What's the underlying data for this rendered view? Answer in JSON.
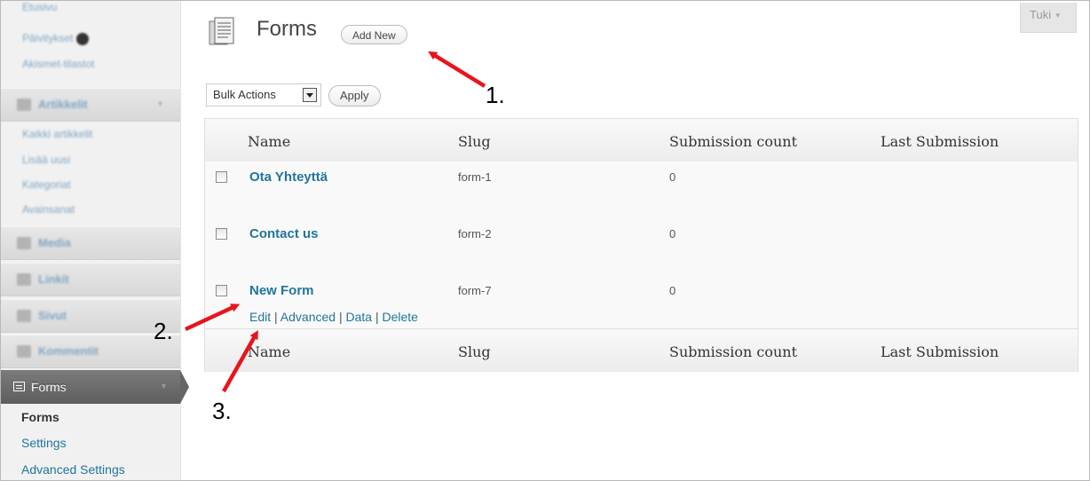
{
  "sidebar": {
    "top_links": [
      "Etusivu",
      "Päivitykset",
      "Akismet-tilastot"
    ],
    "update_badge": "0",
    "posts_header": "Artikkelit",
    "posts_links": [
      "Kaikki artikkelit",
      "Lisää uusi",
      "Kategoriat",
      "Avainsanat"
    ],
    "menu": [
      "Media",
      "Linkit",
      "Sivut",
      "Kommentit"
    ],
    "active_menu": "Forms",
    "submenu": {
      "current": "Forms",
      "items": [
        "Settings",
        "Advanced Settings"
      ]
    }
  },
  "header": {
    "title": "Forms",
    "add_new_label": "Add New",
    "help_tab": "Tuki"
  },
  "toolbar": {
    "bulk_actions_value": "Bulk Actions",
    "apply_label": "Apply"
  },
  "table": {
    "columns": [
      "Name",
      "Slug",
      "Submission count",
      "Last Submission"
    ],
    "rows": [
      {
        "name": "Ota Yhteyttä",
        "slug": "form-1",
        "count": "0",
        "last": ""
      },
      {
        "name": "Contact us",
        "slug": "form-2",
        "count": "0",
        "last": ""
      },
      {
        "name": "New Form",
        "slug": "form-7",
        "count": "0",
        "last": ""
      }
    ],
    "row_actions": [
      "Edit",
      "Advanced",
      "Data",
      "Delete"
    ],
    "action_separator": "|"
  },
  "annotations": {
    "labels": [
      "1.",
      "2.",
      "3."
    ],
    "color": "#e8141c"
  }
}
